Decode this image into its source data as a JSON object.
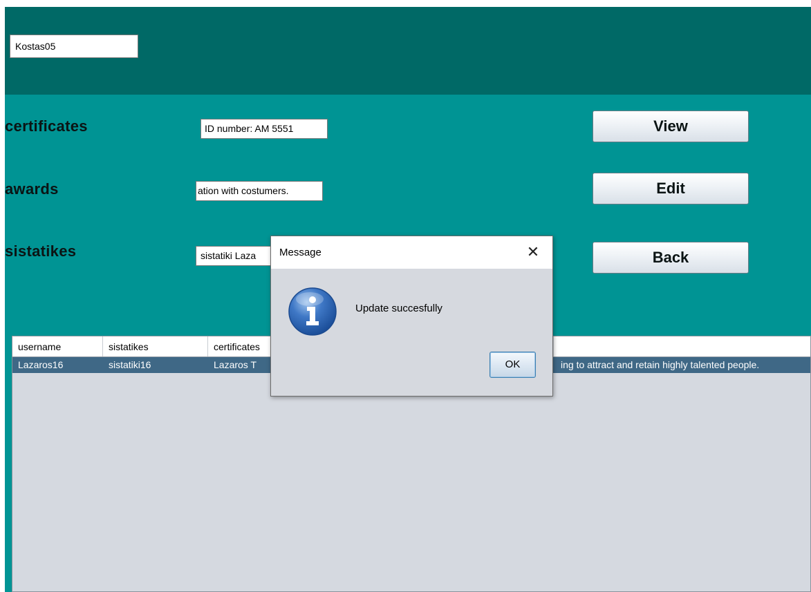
{
  "username_field": {
    "value": "Kostas05"
  },
  "rows": {
    "certificates": {
      "label": "certificates",
      "field_value": "ID number: AM 5551"
    },
    "awards": {
      "label": "awards",
      "field_value": "ation with costumers."
    },
    "sistatikes": {
      "label": "sistatikes",
      "field_value": "sistatiki Laza"
    }
  },
  "buttons": {
    "view": "View",
    "edit": "Edit",
    "back": "Back"
  },
  "table": {
    "columns": [
      "username",
      "sistatikes",
      "certificates"
    ],
    "rows": [
      {
        "username": "Lazaros16",
        "sistatikes": "sistatiki16",
        "certificates": "Lazaros T",
        "overflow_text": "ing to attract and retain highly talented people."
      }
    ],
    "selected_row_color": "#3f6886"
  },
  "dialog": {
    "title": "Message",
    "close_glyph": "✕",
    "message": "Update succesfully",
    "ok_label": "OK",
    "icon": "info-icon"
  },
  "colors": {
    "header_band": "#006966",
    "panel_background": "#009494",
    "table_background": "#d5d9e0"
  }
}
